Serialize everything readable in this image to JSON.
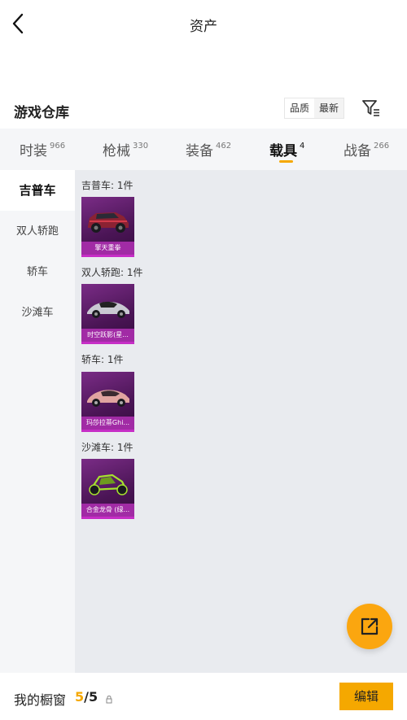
{
  "header": {
    "title": "资产"
  },
  "section": {
    "title": "游戏仓库",
    "sort_options": [
      "品质",
      "最新"
    ]
  },
  "tabs": [
    {
      "label": "时装",
      "count": "966"
    },
    {
      "label": "枪械",
      "count": "330"
    },
    {
      "label": "装备",
      "count": "462"
    },
    {
      "label": "载具",
      "count": "4"
    },
    {
      "label": "战备",
      "count": "266"
    }
  ],
  "active_tab": "载具",
  "sidebar": {
    "items": [
      {
        "label": "吉普车"
      },
      {
        "label": "双人轿跑"
      },
      {
        "label": "轿车"
      },
      {
        "label": "沙滩车"
      }
    ]
  },
  "groups": [
    {
      "label": "吉普车: 1件",
      "item_name": "擎天重拳"
    },
    {
      "label": "双人轿跑: 1件",
      "item_name": "时空跃影(星..."
    },
    {
      "label": "轿车: 1件",
      "item_name": "玛莎拉蒂Ghi..."
    },
    {
      "label": "沙滩车: 1件",
      "item_name": "合金龙骨 (绿..."
    }
  ],
  "bottom": {
    "showcase_label": "我的橱窗",
    "count_current": "5",
    "count_total": "/5",
    "edit_label": "编辑"
  },
  "colors": {
    "accent": "#f5a800",
    "card_bg": "#5e1d6b",
    "card_label": "#a12ba5"
  }
}
